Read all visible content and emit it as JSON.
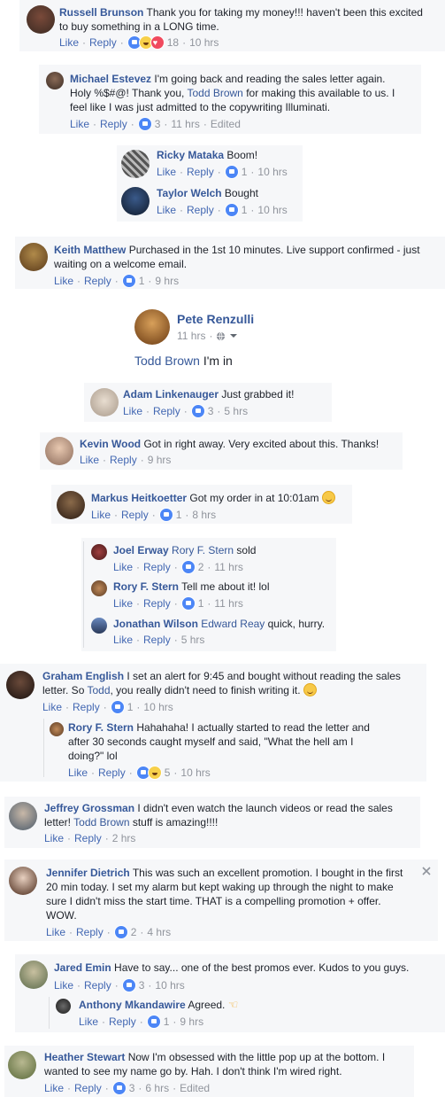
{
  "actions": {
    "like": "Like",
    "reply": "Reply",
    "edited": "Edited"
  },
  "comments": [
    {
      "id": "russell",
      "name": "Russell Brunson",
      "text1": "Thank you for taking my money!!! haven't been this excited",
      "text2": "to buy something in a LONG time.",
      "count": "18",
      "time": "10 hrs"
    },
    {
      "id": "michael",
      "name": "Michael Estevez",
      "text1": "I'm going back and reading the sales letter again.",
      "text2a": "Holy %$#@! Thank you, ",
      "tag": "Todd Brown",
      "text2b": " for making this available to us. I",
      "text3": "feel like I was just admitted to the copywriting Illuminati.",
      "count": "3",
      "time": "11 hrs"
    },
    {
      "id": "ricky",
      "name": "Ricky Mataka",
      "text1": "Boom!",
      "count": "1",
      "time": "10 hrs"
    },
    {
      "id": "taylor",
      "name": "Taylor Welch",
      "text1": "Bought",
      "count": "1",
      "time": "10 hrs"
    },
    {
      "id": "keith",
      "name": "Keith Matthew",
      "text1": "Purchased in the 1st 10 minutes. Live support confirmed - just",
      "text2": "waiting on a welcome email.",
      "count": "1",
      "time": "9 hrs"
    },
    {
      "id": "pete",
      "name": "Pete Renzulli",
      "time": "11 hrs",
      "tag": "Todd Brown",
      "text1": " I'm in"
    },
    {
      "id": "adam",
      "name": "Adam Linkenauger",
      "text1": "Just grabbed it!",
      "count": "3",
      "time": "5 hrs"
    },
    {
      "id": "kevin",
      "name": "Kevin Wood",
      "text1": "Got in right away. Very excited about this. Thanks!",
      "time": "9 hrs"
    },
    {
      "id": "markus",
      "name": "Markus Heitkoetter",
      "text1": "Got my order in at 10:01am",
      "count": "1",
      "time": "8 hrs"
    },
    {
      "id": "joel",
      "name": "Joel Erway",
      "tag": "Rory F. Stern",
      "text1": " sold",
      "count": "2",
      "time": "11 hrs"
    },
    {
      "id": "rory1",
      "name": "Rory F. Stern",
      "text1": "Tell me about it! lol",
      "count": "1",
      "time": "11 hrs"
    },
    {
      "id": "jonathan",
      "name": "Jonathan Wilson",
      "tag": "Edward Reay",
      "text1": " quick, hurry.",
      "time": "5 hrs"
    },
    {
      "id": "graham",
      "name": "Graham English",
      "text1": "I set an alert for 9:45 and bought without reading the sales",
      "text2a": "letter. So ",
      "tag": "Todd",
      "text2b": ", you really didn't need to finish writing it.",
      "count": "1",
      "time": "10 hrs"
    },
    {
      "id": "rory2",
      "name": "Rory F. Stern",
      "text1": "Hahahaha! I actually started to read the letter and",
      "text2": "after 30 seconds caught myself and said, \"What the hell am I",
      "text3": "doing?\" lol",
      "count": "5",
      "time": "10 hrs"
    },
    {
      "id": "jeffrey",
      "name": "Jeffrey Grossman",
      "text1": "I didn't even watch the launch videos or read the sales",
      "tag": "Todd Brown",
      "text2": " stuff is amazing!!!!",
      "text2pre": "letter! ",
      "time": "2 hrs"
    },
    {
      "id": "jennifer",
      "name": "Jennifer Dietrich",
      "text1": "This was such an excellent promotion. I bought in the first",
      "text2": "20 min today. I set my alarm but kept waking up through the night to make",
      "text3": "sure I didn't miss the start time. THAT is a compelling promotion + offer.",
      "text4": "WOW.",
      "count": "2",
      "time": "4 hrs"
    },
    {
      "id": "jared",
      "name": "Jared Emin",
      "text1": "Have to say... one of the best promos ever. Kudos to you guys.",
      "count": "3",
      "time": "10 hrs"
    },
    {
      "id": "anthony",
      "name": "Anthony Mkandawire",
      "text1": "Agreed.",
      "count": "1",
      "time": "9 hrs"
    },
    {
      "id": "heather",
      "name": "Heather Stewart",
      "text1": "Now I'm obsessed with the little pop up at the bottom. I",
      "text2": "wanted to see my name go by. Hah. I don't think I'm wired right.",
      "count": "3",
      "time": "6 hrs"
    }
  ],
  "icons": {
    "globe": "globe-icon",
    "chevron": "chevron-down-icon",
    "close": "close-icon"
  },
  "colors": {
    "name": "#365899",
    "link": "#4267b2",
    "meta": "#90949c",
    "card": "#f6f7f9"
  }
}
